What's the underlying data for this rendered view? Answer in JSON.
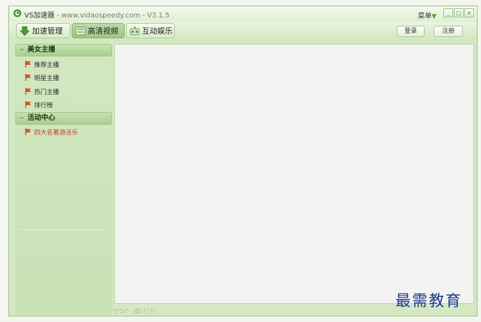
{
  "window": {
    "title": "VS加速器",
    "subtitle": "- www.vidaospeedy.com - V3.1.5",
    "menu_label": "菜单",
    "menu_arrow": "▼"
  },
  "window_controls": [
    {
      "name": "minimize",
      "glyph": "_"
    },
    {
      "name": "maximize",
      "glyph": "□"
    },
    {
      "name": "close",
      "glyph": "×"
    }
  ],
  "tabs": [
    {
      "label": "加速管理",
      "active": false
    },
    {
      "label": "高清视频",
      "active": true
    },
    {
      "label": "互动娱乐",
      "active": false
    }
  ],
  "auth": {
    "login_label": "登录",
    "register_label": "注册"
  },
  "sidebar": {
    "groups": [
      {
        "title": "美女主播",
        "items": [
          {
            "label": "推荐主播"
          },
          {
            "label": "明星主播"
          },
          {
            "label": "热门主播"
          },
          {
            "label": "排行榜"
          }
        ]
      },
      {
        "title": "活动中心",
        "items": [
          {
            "label": "四大名著游活乐"
          }
        ]
      }
    ]
  },
  "status": {
    "text": "\"(F5)\" - 成(-) (?)"
  },
  "watermark": "最需教育",
  "colors": {
    "window_bg": "#d5e8c4",
    "active_tab": "#9fc785",
    "accent_green": "#4aa52e",
    "red_item": "#c43a2a",
    "watermark": "#1c3690"
  }
}
